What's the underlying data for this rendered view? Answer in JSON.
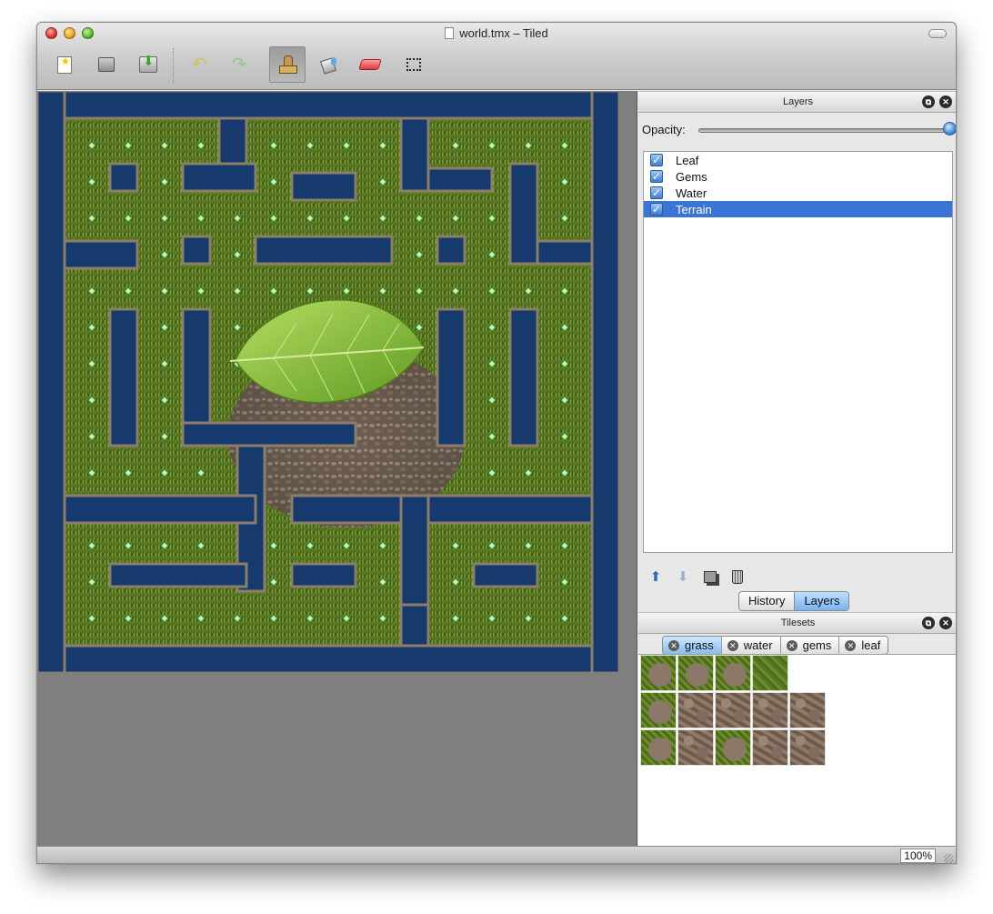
{
  "window": {
    "title": "world.tmx – Tiled"
  },
  "toolbar": {
    "buttons": [
      {
        "name": "new-map-button",
        "icon": "new-document-icon"
      },
      {
        "name": "open-button",
        "icon": "open-folder-icon"
      },
      {
        "name": "save-button",
        "icon": "save-icon"
      },
      {
        "name": "undo-button",
        "icon": "undo-icon"
      },
      {
        "name": "redo-button",
        "icon": "redo-icon"
      },
      {
        "name": "stamp-brush-button",
        "icon": "stamp-icon",
        "active": true
      },
      {
        "name": "bucket-fill-button",
        "icon": "bucket-fill-icon"
      },
      {
        "name": "eraser-button",
        "icon": "eraser-icon"
      },
      {
        "name": "rectangle-select-button",
        "icon": "rectangle-select-icon"
      }
    ]
  },
  "layers_panel": {
    "title": "Layers",
    "opacity_label": "Opacity:",
    "opacity_value": 1.0,
    "layers": [
      {
        "name": "Leaf",
        "visible": true,
        "selected": false
      },
      {
        "name": "Gems",
        "visible": true,
        "selected": false
      },
      {
        "name": "Water",
        "visible": true,
        "selected": false
      },
      {
        "name": "Terrain",
        "visible": true,
        "selected": true
      }
    ],
    "tabs": [
      {
        "label": "History",
        "active": false
      },
      {
        "label": "Layers",
        "active": true
      }
    ]
  },
  "tilesets_panel": {
    "title": "Tilesets",
    "tabs": [
      {
        "label": "grass",
        "active": true
      },
      {
        "label": "water",
        "active": false
      },
      {
        "label": "gems",
        "active": false
      },
      {
        "label": "leaf",
        "active": false
      }
    ]
  },
  "statusbar": {
    "zoom": "100%"
  },
  "colors": {
    "water": "#163a6e",
    "grass": "#5a7a25",
    "dirt": "#7c6a5c",
    "leaf": "#8fc43a",
    "selection": "#3875d7"
  }
}
